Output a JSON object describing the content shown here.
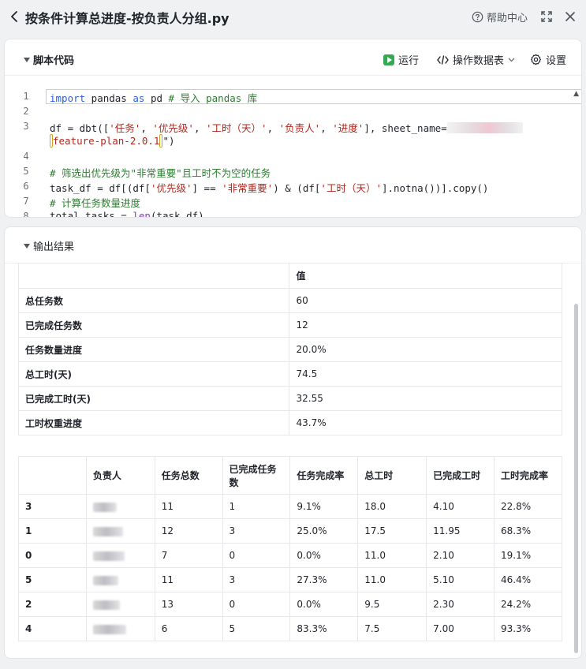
{
  "header": {
    "title": "按条件计算总进度-按负责人分组.py",
    "help_label": "帮助中心"
  },
  "script_section": {
    "title": "脚本代码",
    "run_label": "运行",
    "data_table_label": "操作数据表",
    "settings_label": "设置"
  },
  "code": {
    "line_numbers": [
      "1",
      "2",
      "3",
      "4",
      "5",
      "6",
      "7",
      "8"
    ],
    "l1_kw1": "import",
    "l1_mid": " pandas ",
    "l1_kw2": "as",
    "l1_tail": " pd ",
    "l1_cm": "# 导入 pandas 库",
    "l3_a": "df = dbt([",
    "l3_s1": "'任务'",
    "l3_c1": ", ",
    "l3_s2": "'优先级'",
    "l3_c2": ", ",
    "l3_s3": "'工时（天）'",
    "l3_c3": ", ",
    "l3_s4": "'负责人'",
    "l3_c4": ", ",
    "l3_s5": "'进度'",
    "l3_b": "], sheet_name=",
    "l3w_q": "\"",
    "l3w_s": "feature-plan-2.0.1",
    "l3w_tail": "\")",
    "l5_cm": "# 筛选出优先级为\"非常重要\"且工时不为空的任务",
    "l6_a": "task_df = df[(df[",
    "l6_s1": "'优先级'",
    "l6_b": "] == ",
    "l6_s2": "'非常重要'",
    "l6_c": ") & (df[",
    "l6_s3": "'工时（天）'",
    "l6_d": "].notna())].copy()",
    "l7_cm": "# 计算任务数量进度",
    "l8_a": "total_tasks = ",
    "l8_fn": "len",
    "l8_b": "(task_df)"
  },
  "output_section": {
    "title": "输出结果"
  },
  "summary_table": {
    "header": [
      "",
      "值"
    ],
    "rows": [
      {
        "label": "总任务数",
        "value": "60"
      },
      {
        "label": "已完成任务数",
        "value": "12"
      },
      {
        "label": "任务数量进度",
        "value": "20.0%"
      },
      {
        "label": "总工时(天)",
        "value": "74.5"
      },
      {
        "label": "已完成工时(天)",
        "value": "32.55"
      },
      {
        "label": "工时权重进度",
        "value": "43.7%"
      }
    ]
  },
  "group_table": {
    "header": [
      "",
      "负责人",
      "任务总数",
      "已完成任务数",
      "任务完成率",
      "总工时",
      "已完成工时",
      "工时完成率"
    ],
    "rows": [
      {
        "index": "3",
        "total": "11",
        "done": "1",
        "task_rate": "9.1%",
        "hours": "18.0",
        "done_hours": "4.10",
        "hour_rate": "22.8%"
      },
      {
        "index": "1",
        "total": "12",
        "done": "3",
        "task_rate": "25.0%",
        "hours": "17.5",
        "done_hours": "11.95",
        "hour_rate": "68.3%"
      },
      {
        "index": "0",
        "total": "7",
        "done": "0",
        "task_rate": "0.0%",
        "hours": "11.0",
        "done_hours": "2.10",
        "hour_rate": "19.1%"
      },
      {
        "index": "5",
        "total": "11",
        "done": "3",
        "task_rate": "27.3%",
        "hours": "11.0",
        "done_hours": "5.10",
        "hour_rate": "46.4%"
      },
      {
        "index": "2",
        "total": "13",
        "done": "0",
        "task_rate": "0.0%",
        "hours": "9.5",
        "done_hours": "2.30",
        "hour_rate": "24.2%"
      },
      {
        "index": "4",
        "total": "6",
        "done": "5",
        "task_rate": "83.3%",
        "hours": "7.5",
        "done_hours": "7.00",
        "hour_rate": "93.3%"
      }
    ]
  }
}
